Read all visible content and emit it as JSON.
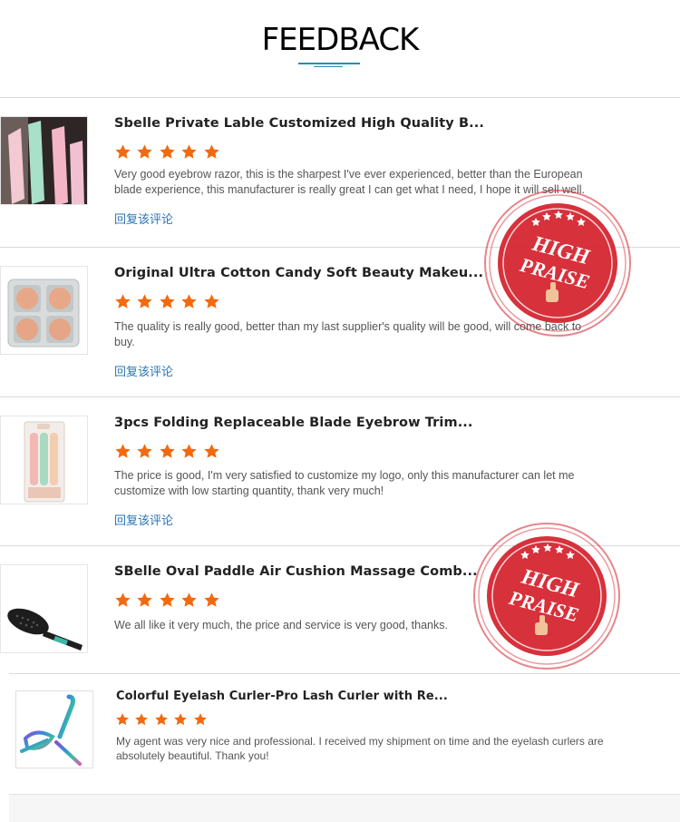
{
  "header": {
    "title": "FEEDBACK"
  },
  "reviews": [
    {
      "product_title": "Sbelle Private Lable Customized High Quality B...",
      "rating": 5,
      "comment": "Very good eyebrow razor, this is the sharpest I've ever experienced, better than the European blade experience, this manufacturer is really great I can get what I need, I hope it will sell well.",
      "reply_label": "回复该评论"
    },
    {
      "product_title": "Original Ultra Cotton Candy Soft Beauty Makeu...",
      "rating": 5,
      "comment": "The quality is really good, better than my last supplier's quality will be good, will come back to buy.",
      "reply_label": "回复该评论"
    },
    {
      "product_title": "3pcs Folding Replaceable Blade Eyebrow Trim...",
      "rating": 5,
      "comment": "The price is good, I'm very satisfied to customize my logo, only this manufacturer can let me customize with low starting quantity, thank very much!",
      "reply_label": "回复该评论"
    },
    {
      "product_title": "SBelle Oval Paddle Air Cushion Massage Comb...",
      "rating": 5,
      "comment": "We all like it very much, the price and service is very good, thanks."
    },
    {
      "product_title": "Colorful Eyelash Curler-Pro Lash Curler with Re...",
      "rating": 5,
      "comment": "My agent was very nice and professional. I received my shipment on time and the eyelash curlers are absolutely beautiful. Thank you!"
    }
  ],
  "stamps": [
    {
      "line1": "HIGH",
      "line2": "PRAISE"
    },
    {
      "line1": "HIGH",
      "line2": "PRAISE"
    }
  ],
  "colors": {
    "star": "#f26a0f",
    "link": "#2a75b8",
    "stamp": "#d4202a"
  }
}
